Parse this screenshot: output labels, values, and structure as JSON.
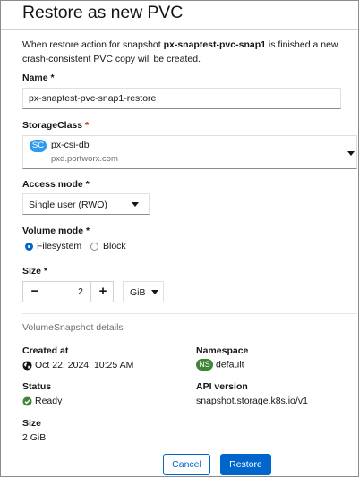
{
  "modal": {
    "title": "Restore as new PVC",
    "description": {
      "before": "When restore action for snapshot ",
      "snapshot_name": "px-snaptest-pvc-snap1",
      "after": " is finished a new crash-consistent PVC copy will be created."
    }
  },
  "form": {
    "name": {
      "label": "Name",
      "required_mark": "*",
      "value": "px-snaptest-pvc-snap1-restore"
    },
    "storage_class": {
      "label": "StorageClass",
      "required_mark": "*",
      "badge": "SC",
      "value": "px-csi-db",
      "provisioner": "pxd.portworx.com"
    },
    "access_mode": {
      "label": "Access mode",
      "required_mark": "*",
      "value": "Single user (RWO)"
    },
    "volume_mode": {
      "label": "Volume mode",
      "required_mark": "*",
      "options": [
        {
          "label": "Filesystem",
          "checked": true
        },
        {
          "label": "Block",
          "checked": false
        }
      ]
    },
    "size": {
      "label": "Size",
      "required_mark": "*",
      "minus": "−",
      "plus": "+",
      "value": "2",
      "unit": "GiB"
    }
  },
  "details": {
    "section_title": "VolumeSnapshot details",
    "created_at": {
      "label": "Created at",
      "value": "Oct 22, 2024, 10:25 AM"
    },
    "namespace": {
      "label": "Namespace",
      "badge": "NS",
      "value": "default"
    },
    "status": {
      "label": "Status",
      "value": "Ready"
    },
    "api_version": {
      "label": "API version",
      "value": "snapshot.storage.k8s.io/v1"
    },
    "size": {
      "label": "Size",
      "value": "2 GiB"
    }
  },
  "footer": {
    "cancel_label": "Cancel",
    "restore_label": "Restore"
  },
  "colors": {
    "primary": "#0066cc",
    "required": "#c9190b",
    "sc_badge": "#2b9af3",
    "ns_badge": "#3e8635",
    "success": "#3e8635"
  }
}
